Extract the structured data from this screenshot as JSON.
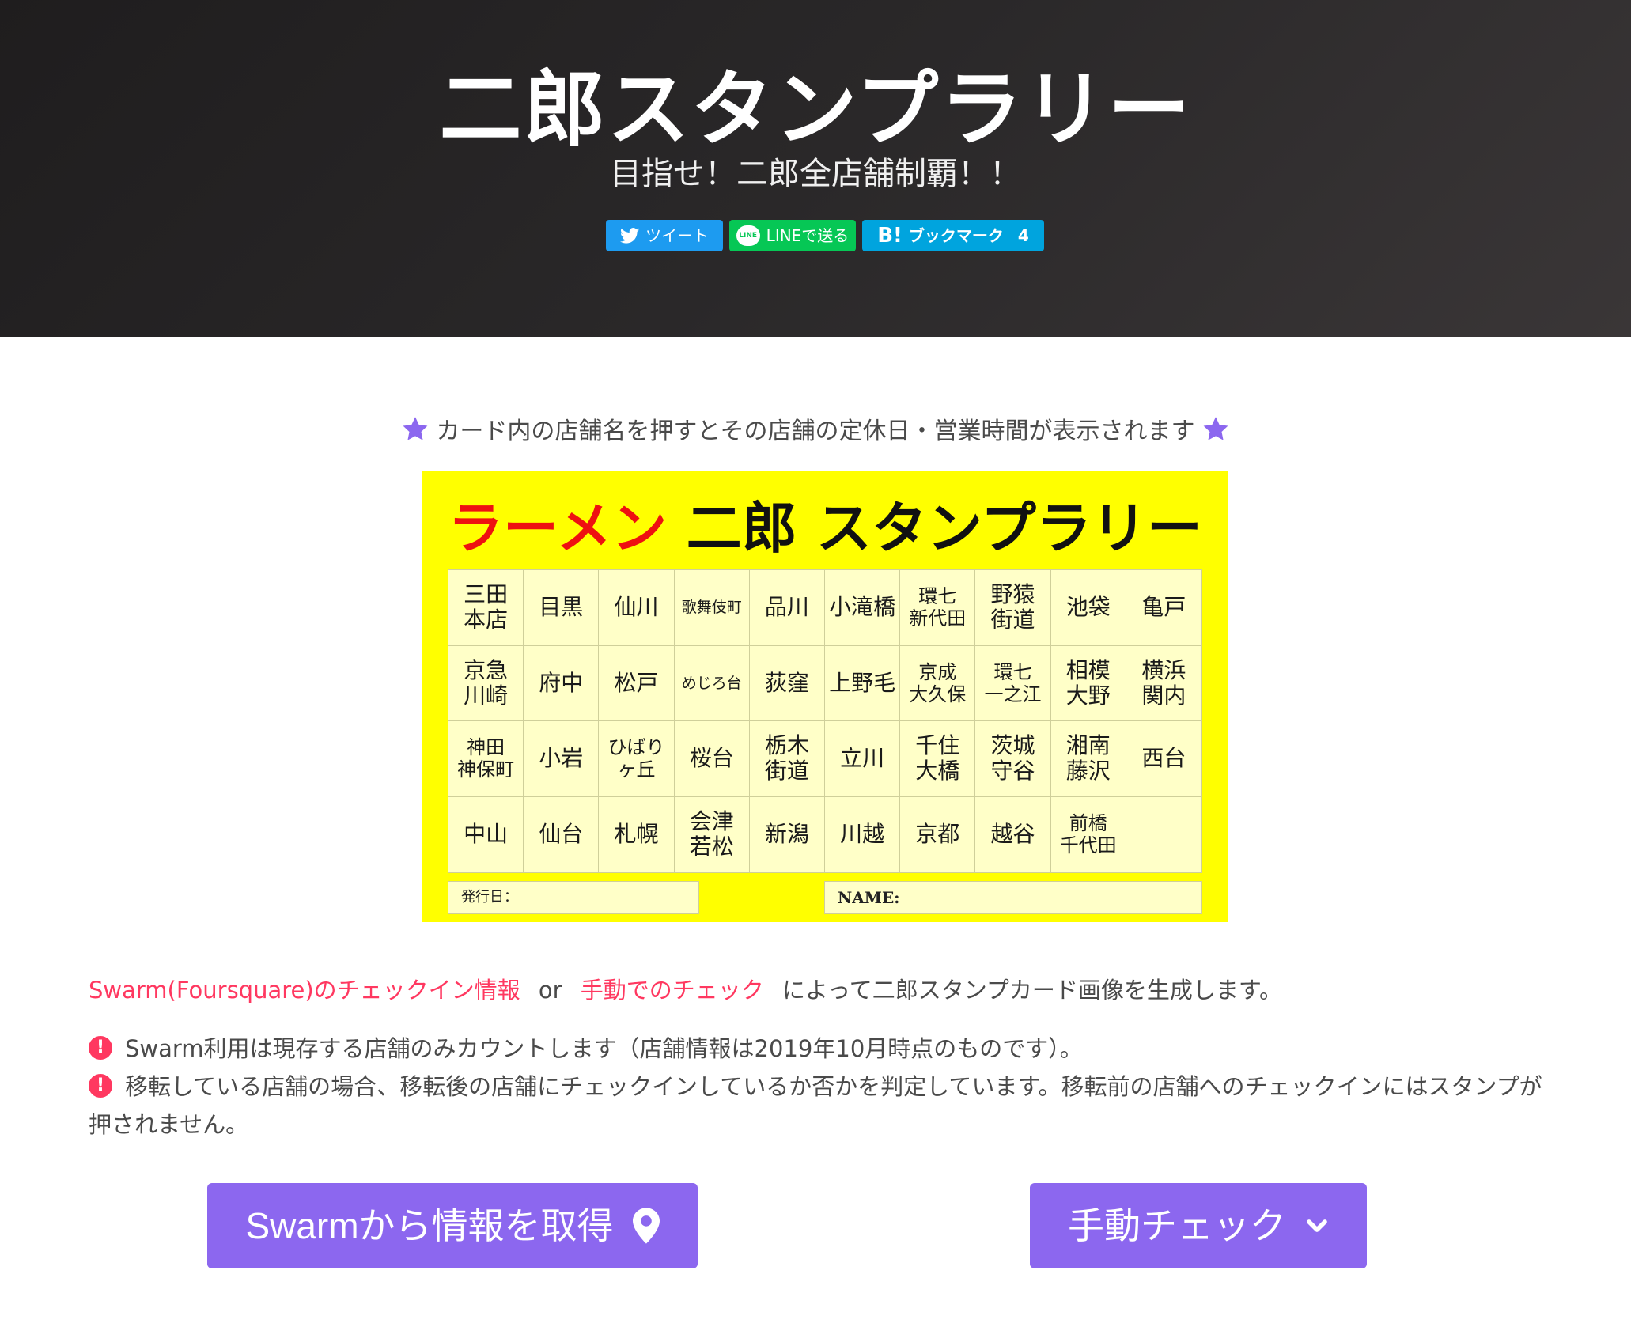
{
  "hero": {
    "title": "二郎スタンプラリー",
    "subtitle": "目指せ！二郎全店舗制覇！！",
    "share": {
      "tweet_label": "ツイート",
      "line_label": "LINEで送る",
      "line_badge": "LINE",
      "hatena_b": "B!",
      "hatena_label": "ブックマーク",
      "hatena_count": "4"
    }
  },
  "notice": "カード内の店舗名を押すとその店舗の定休日・営業時間が表示されます",
  "card": {
    "title_red": "ラーメン",
    "title_black": "二郎 スタンプラリー",
    "rows": [
      [
        "三田\n本店",
        "目黒",
        "仙川",
        "歌舞伎町",
        "品川",
        "小滝橋",
        "環七\n新代田",
        "野猿\n街道",
        "池袋",
        "亀戸"
      ],
      [
        "京急\n川崎",
        "府中",
        "松戸",
        "めじろ台",
        "荻窪",
        "上野毛",
        "京成\n大久保",
        "環七\n一之江",
        "相模\n大野",
        "横浜\n関内"
      ],
      [
        "神田\n神保町",
        "小岩",
        "ひばり\nヶ丘",
        "桜台",
        "栃木\n街道",
        "立川",
        "千住\n大橋",
        "茨城\n守谷",
        "湘南\n藤沢",
        "西台"
      ],
      [
        "中山",
        "仙台",
        "札幌",
        "会津\n若松",
        "新潟",
        "川越",
        "京都",
        "越谷",
        "前橋\n千代田",
        ""
      ]
    ],
    "date_label": "発行日：",
    "name_label": "NAME:"
  },
  "desc": {
    "link_swarm": "Swarm(Foursquare)のチェックイン情報",
    "or": "or",
    "link_manual": "手動でのチェック",
    "rest": "によって二郎スタンプカード画像を生成します。"
  },
  "warnings": [
    "Swarm利用は現存する店舗のみカウントします（店舗情報は2019年10月時点のものです）。",
    "移転している店舗の場合、移転後の店舗にチェックインしているか否かを判定しています。移転前の店舗へのチェックインにはスタンプが押されません。"
  ],
  "buttons": {
    "swarm_label": "Swarmから情報を取得",
    "manual_label": "手動チェック"
  },
  "icons": {
    "star_color": "#8c67ef",
    "warn_color": "#ff3860",
    "twitter_color": "#1d9bf0",
    "line_color": "#06c755",
    "hatena_color": "#00a4de"
  }
}
